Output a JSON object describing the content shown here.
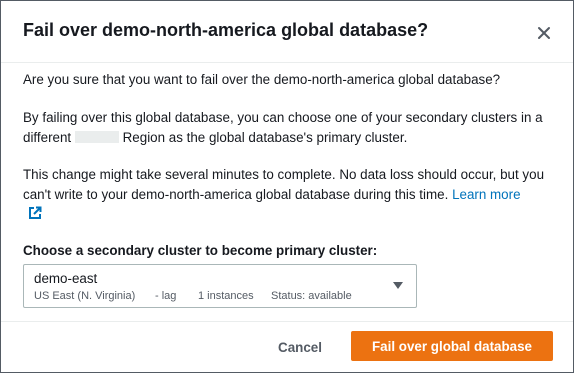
{
  "dialog": {
    "title": "Fail over demo-north-america global database?",
    "close_icon": "close-icon",
    "confirm_text": "Are you sure that you want to fail over the demo-north-america global database?",
    "description_part1": "By failing over this global database, you can choose one of your secondary clusters in a different",
    "description_part2": "Region as the global database's primary cluster.",
    "warning_text": "This change might take several minutes to complete. No data loss should occur, but you can't write to your demo-north-america global database during this time.",
    "learn_more": "Learn more",
    "learn_more_icon": "external-link-icon"
  },
  "select": {
    "label": "Choose a secondary cluster to become primary cluster:",
    "selected_name": "demo-east",
    "region": "US East (N. Virginia)",
    "lag": "- lag",
    "instances": "1 instances",
    "status": "Status: available",
    "caret_icon": "caret-down-icon"
  },
  "footer": {
    "cancel_label": "Cancel",
    "primary_label": "Fail over global database"
  },
  "colors": {
    "primary": "#ec7211",
    "link": "#0073bb",
    "text": "#16191f",
    "muted": "#545b64"
  }
}
